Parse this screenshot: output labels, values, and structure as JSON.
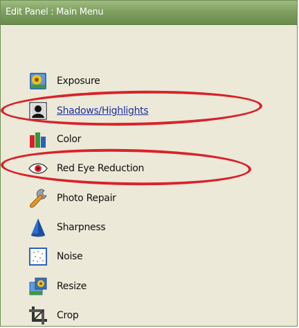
{
  "window": {
    "title": "Edit Panel : Main Menu"
  },
  "menu": {
    "items": [
      {
        "label": "Exposure",
        "icon": "exposure-icon"
      },
      {
        "label": "Shadows/Highlights",
        "icon": "shadows-highlights-icon",
        "style": "link"
      },
      {
        "label": "Color",
        "icon": "color-bars-icon"
      },
      {
        "label": "Red Eye Reduction",
        "icon": "red-eye-icon"
      },
      {
        "label": "Photo Repair",
        "icon": "wrench-icon"
      },
      {
        "label": "Sharpness",
        "icon": "sharpness-cone-icon"
      },
      {
        "label": "Noise",
        "icon": "noise-icon"
      },
      {
        "label": "Resize",
        "icon": "resize-icon"
      },
      {
        "label": "Crop",
        "icon": "crop-icon"
      }
    ]
  },
  "annotations": {
    "highlight_color": "#d8232a",
    "highlighted_items": [
      "Shadows/Highlights",
      "Red Eye Reduction"
    ]
  },
  "colors": {
    "titlebar": "#7fa060",
    "panel_background": "#ece9d8",
    "link": "#1f2fa0"
  }
}
